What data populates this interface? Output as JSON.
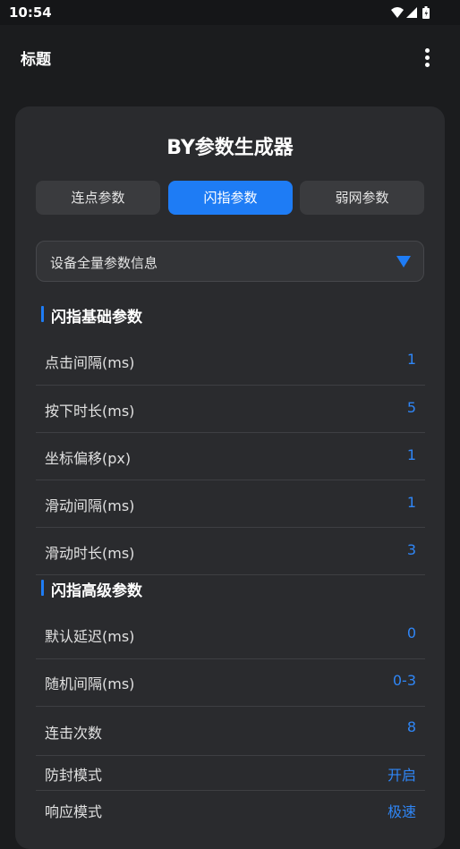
{
  "status_bar": {
    "time": "10:54",
    "icons": [
      "wifi-icon",
      "signal-icon",
      "battery-icon"
    ]
  },
  "app_bar": {
    "title": "标题",
    "menu_icon": "more-vert-icon"
  },
  "card": {
    "title": "BY参数生成器",
    "tabs": [
      {
        "label": "连点参数",
        "active": false
      },
      {
        "label": "闪指参数",
        "active": true
      },
      {
        "label": "弱网参数",
        "active": false
      }
    ],
    "dropdown": {
      "selected": "设备全量参数信息",
      "icon": "triangle-down-icon"
    },
    "sections": [
      {
        "heading": "闪指基础参数",
        "rows": [
          {
            "label": "点击间隔(ms)",
            "value": "1"
          },
          {
            "label": "按下时长(ms)",
            "value": "5"
          },
          {
            "label": "坐标偏移(px)",
            "value": "1"
          },
          {
            "label": "滑动间隔(ms)",
            "value": "1"
          },
          {
            "label": "滑动时长(ms)",
            "value": "3"
          }
        ]
      },
      {
        "heading": "闪指高级参数",
        "rows": [
          {
            "label": "默认延迟(ms)",
            "value": "0"
          },
          {
            "label": "随机间隔(ms)",
            "value": "0-3"
          },
          {
            "label": "连击次数",
            "value": "8"
          },
          {
            "label": "防封模式",
            "value": "开启"
          },
          {
            "label": "响应模式",
            "value": "极速"
          }
        ]
      }
    ]
  },
  "colors": {
    "accent": "#1e7cf5",
    "value_text": "#2f86f6",
    "card_bg": "#2a2b2e",
    "page_bg": "#1b1c1e"
  }
}
